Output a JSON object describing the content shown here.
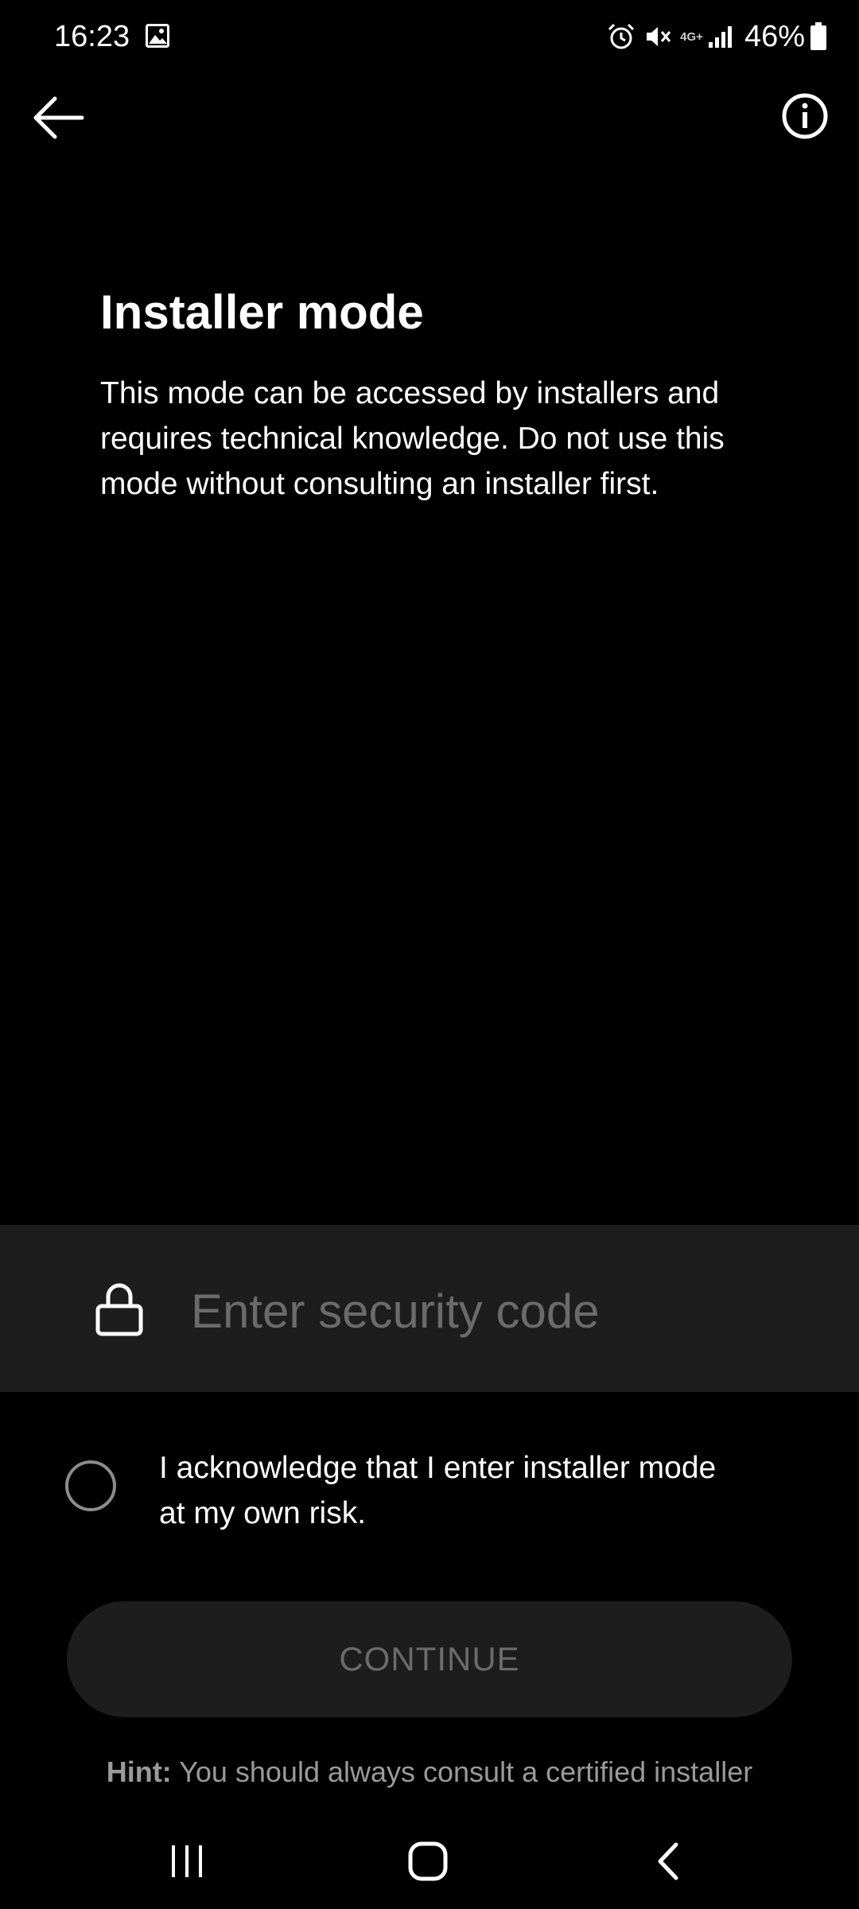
{
  "status_bar": {
    "time": "16:23",
    "network_type": "4G+",
    "battery_percent": "46%",
    "icons": [
      "gallery-icon",
      "alarm-icon",
      "mute-icon",
      "signal-icon",
      "battery-icon"
    ]
  },
  "header": {
    "back_icon": "arrow-left-icon",
    "info_icon": "info-icon"
  },
  "main": {
    "title": "Installer mode",
    "description": "This mode can be accessed by installers and requires technical knowledge. Do not use this mode without consulting an installer first."
  },
  "security_code": {
    "placeholder": "Enter security code",
    "value": "",
    "icon": "lock-icon"
  },
  "acknowledge": {
    "label": "I acknowledge that I enter installer mode at my own risk.",
    "checked": false
  },
  "continue_button": {
    "label": "CONTINUE",
    "enabled": false
  },
  "hint": {
    "label": "Hint:",
    "text": "You should always consult a certified installer"
  },
  "colors": {
    "background": "#000000",
    "panel": "#1d1d1d",
    "placeholder": "#6b6b6b",
    "text": "#ffffff",
    "hint": "#9a9a9a"
  },
  "nav_bar": {
    "icons": [
      "recent-apps-icon",
      "home-icon",
      "back-icon"
    ]
  }
}
